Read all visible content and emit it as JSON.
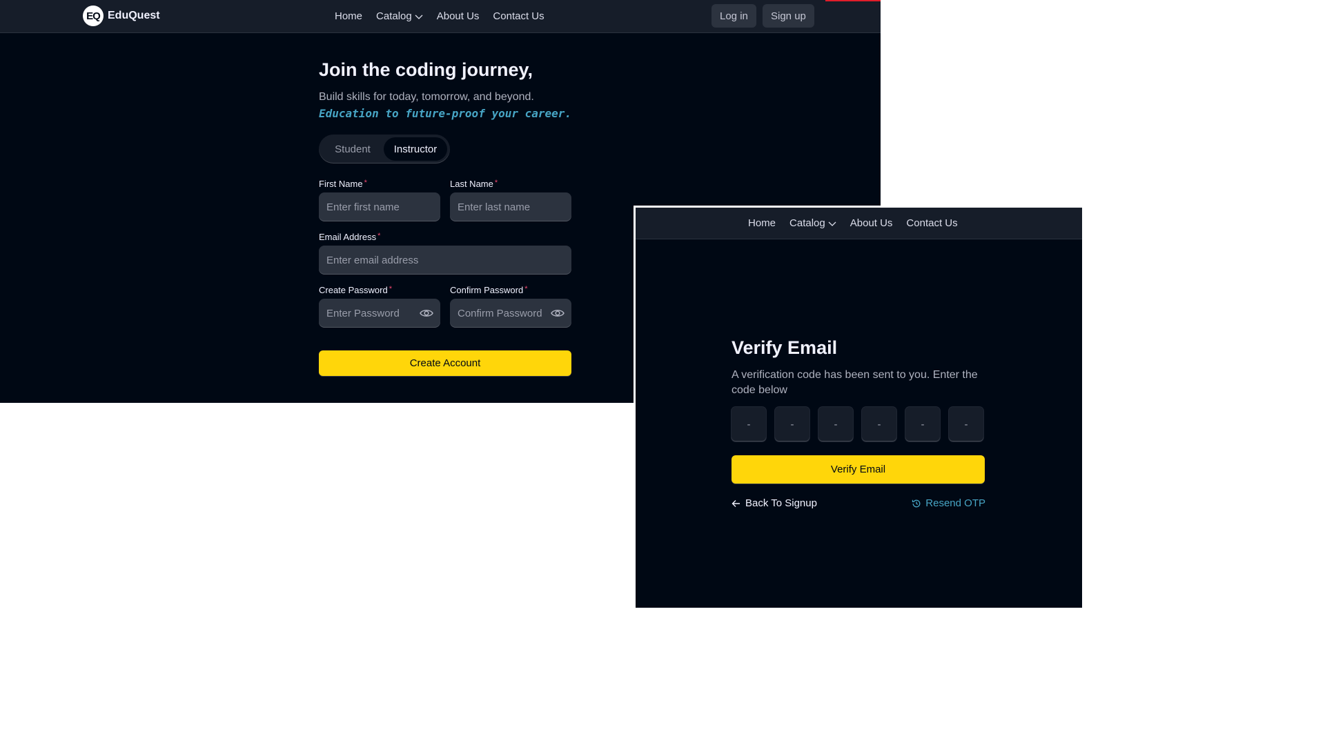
{
  "brand": {
    "logo_mark": "EQ",
    "name": "EduQuest"
  },
  "nav": {
    "links": [
      {
        "label": "Home"
      },
      {
        "label": "Catalog"
      },
      {
        "label": "About Us"
      },
      {
        "label": "Contact Us"
      }
    ],
    "login": "Log in",
    "signup": "Sign up"
  },
  "signup": {
    "heading": "Join the coding journey,",
    "subtitle": "Build skills for today, tomorrow, and beyond.",
    "tagline": "Education to future-proof your career.",
    "role_toggle": {
      "options": [
        "Student",
        "Instructor"
      ],
      "selected": "Instructor"
    },
    "required_mark": "*",
    "fields": {
      "first_name": {
        "label": "First Name",
        "placeholder": "Enter first name"
      },
      "last_name": {
        "label": "Last Name",
        "placeholder": "Enter last name"
      },
      "email": {
        "label": "Email Address",
        "placeholder": "Enter email address"
      },
      "password": {
        "label": "Create Password",
        "placeholder": "Enter Password"
      },
      "confirm_password": {
        "label": "Confirm Password",
        "placeholder": "Confirm Password"
      }
    },
    "submit": "Create Account"
  },
  "verify": {
    "title": "Verify Email",
    "description": "A verification code has been sent to you. Enter the code below",
    "otp_placeholder": [
      "-",
      "-",
      "-",
      "-",
      "-",
      "-"
    ],
    "submit": "Verify Email",
    "back": "Back To Signup",
    "resend": "Resend OTP"
  },
  "colors": {
    "background": "#000814",
    "navbar": "#161d29",
    "input": "#2c333f",
    "accent_yellow": "#ffd60a",
    "accent_blue": "#47a5c5",
    "required": "#ef476f",
    "top_accent": "#e11d2a"
  },
  "icons": [
    "logo-icon",
    "chevron-down-icon",
    "eye-icon",
    "arrow-left-icon",
    "history-icon"
  ]
}
